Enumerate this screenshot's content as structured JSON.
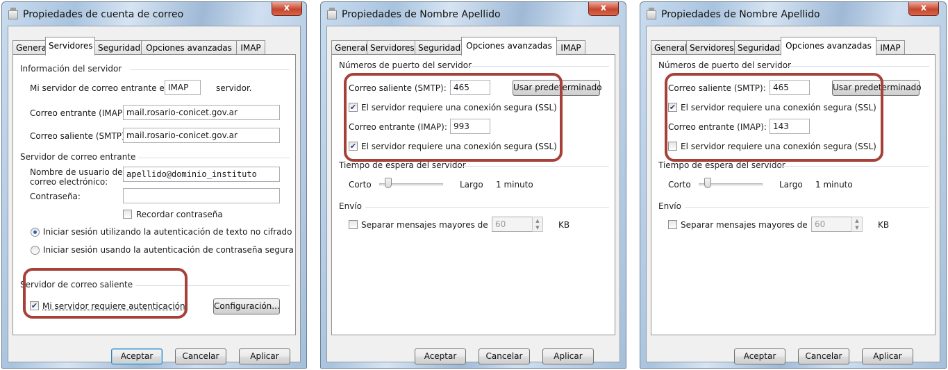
{
  "colors": {
    "highlight": "#a6413a",
    "title_bar": "#b7cde5",
    "close_button": "#c8452c"
  },
  "icons": {
    "app_icon": "window-app-icon",
    "close_icon": "close-icon"
  },
  "window1": {
    "title": "Propiedades de cuenta de correo",
    "close_label": "x",
    "tabs": [
      "General",
      "Servidores",
      "Seguridad",
      "Opciones avanzadas",
      "IMAP"
    ],
    "active_tab": "Servidores",
    "server_info": {
      "header": "Información del servidor",
      "incoming_type_prefix": "Mi servidor de correo entrante es",
      "incoming_type_value": "IMAP",
      "incoming_type_suffix": "servidor.",
      "incoming_label": "Correo entrante (IMAP):",
      "incoming_value": "mail.rosario-conicet.gov.ar",
      "outgoing_label": "Correo saliente (SMTP):",
      "outgoing_value": "mail.rosario-conicet.gov.ar"
    },
    "incoming_server": {
      "header": "Servidor de correo entrante",
      "username_label": "Nombre de usuario de correo electrónico:",
      "username_value": "apellido@dominio_instituto",
      "password_label": "Contraseña:",
      "password_value": "",
      "remember_label": "Recordar contraseña",
      "remember_checked": false,
      "radio_plain": "Iniciar sesión utilizando la autenticación de texto no cifrado",
      "radio_plain_selected": true,
      "radio_secure": "Iniciar sesión usando la autenticación de contraseña segura",
      "radio_secure_selected": false
    },
    "outgoing_server": {
      "header": "Servidor de correo saliente",
      "auth_label": "Mi servidor requiere autenticación",
      "auth_checked": true,
      "config_button": "Configuración..."
    },
    "buttons": {
      "ok": "Aceptar",
      "cancel": "Cancelar",
      "apply": "Aplicar"
    }
  },
  "window2": {
    "title": "Propiedades de Nombre Apellido",
    "close_label": "x",
    "tabs": [
      "General",
      "Servidores",
      "Seguridad",
      "Opciones avanzadas",
      "IMAP"
    ],
    "active_tab": "Opciones avanzadas",
    "ports": {
      "header": "Números de puerto del servidor",
      "smtp_label": "Correo saliente (SMTP):",
      "smtp_value": "465",
      "default_button": "Usar predeterminado",
      "smtp_ssl_label": "El servidor requiere una conexión segura (SSL)",
      "smtp_ssl_checked": true,
      "imap_label": "Correo entrante (IMAP):",
      "imap_value": "993",
      "imap_ssl_label": "El servidor requiere una conexión segura (SSL)",
      "imap_ssl_checked": true
    },
    "timeout": {
      "header": "Tiempo de espera del servidor",
      "short": "Corto",
      "long": "Largo",
      "value": "1 minuto",
      "level": 0.1
    },
    "sending": {
      "header": "Envío",
      "split_label": "Separar mensajes mayores de",
      "split_checked": false,
      "split_value": "60",
      "unit": "KB"
    },
    "buttons": {
      "ok": "Aceptar",
      "cancel": "Cancelar",
      "apply": "Aplicar"
    }
  },
  "window3": {
    "title": "Propiedades de Nombre Apellido",
    "close_label": "x",
    "tabs": [
      "General",
      "Servidores",
      "Seguridad",
      "Opciones avanzadas",
      "IMAP"
    ],
    "active_tab": "Opciones avanzadas",
    "ports": {
      "header": "Números de puerto del servidor",
      "smtp_label": "Correo saliente (SMTP):",
      "smtp_value": "465",
      "default_button": "Usar predeterminado",
      "smtp_ssl_label": "El servidor requiere una conexión segura (SSL)",
      "smtp_ssl_checked": true,
      "imap_label": "Correo entrante (IMAP):",
      "imap_value": "143",
      "imap_ssl_label": "El servidor requiere una conexión segura (SSL)",
      "imap_ssl_checked": false
    },
    "timeout": {
      "header": "Tiempo de espera del servidor",
      "short": "Corto",
      "long": "Largo",
      "value": "1 minuto",
      "level": 0.1
    },
    "sending": {
      "header": "Envío",
      "split_label": "Separar mensajes mayores de",
      "split_checked": false,
      "split_value": "60",
      "unit": "KB"
    },
    "buttons": {
      "ok": "Aceptar",
      "cancel": "Cancelar",
      "apply": "Aplicar"
    }
  }
}
